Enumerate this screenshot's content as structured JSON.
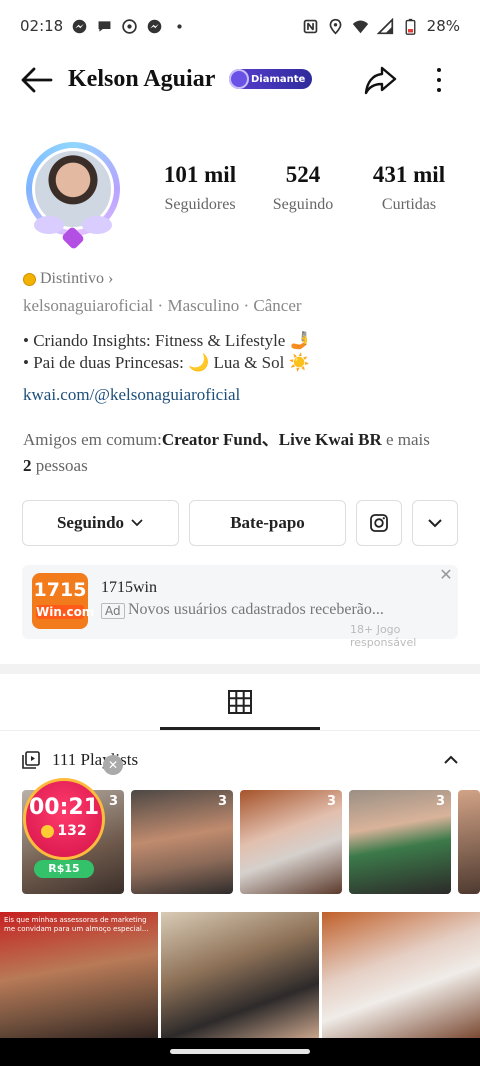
{
  "status_bar": {
    "time": "02:18",
    "notification_icons": [
      "messenger-icon",
      "chat-icon",
      "whatsapp-icon",
      "messenger-icon",
      "dot-icon"
    ],
    "system_icons": [
      "nfc-icon",
      "location-icon",
      "wifi-icon",
      "signal-icon",
      "battery-icon"
    ],
    "battery": "28%"
  },
  "header": {
    "name": "Kelson Aguiar",
    "tier": "Diamante",
    "tier_color": "#3b2fb0"
  },
  "stats": [
    {
      "value": "101 mil",
      "label": "Seguidores"
    },
    {
      "value": "524",
      "label": "Seguindo"
    },
    {
      "value": "431 mil",
      "label": "Curtidas"
    }
  ],
  "profile": {
    "badge_label": "Distintivo",
    "badge_chevron": "›",
    "meta": [
      "kelsonaguiaroficial",
      "Masculino",
      "Câncer"
    ],
    "meta_separator": " · ",
    "bio": [
      "• Criando Insights: Fitness & Lifestyle 🤳",
      "• Pai de duas Princesas: 🌙 Lua & Sol ☀️"
    ],
    "link": "kwai.com/@kelsonaguiaroficial",
    "mutual_prefix": "Amigos em comum:",
    "mutual_names": "Creator Fund、Live Kwai BR",
    "mutual_suffix": " e mais",
    "mutual_count": "2",
    "mutual_unit": " pessoas"
  },
  "actions": {
    "following_label": "Seguindo",
    "chat_label": "Bate-papo"
  },
  "ad": {
    "logo_number": "1715",
    "logo_word": "Win.com",
    "name": "1715win",
    "tag": "Ad",
    "text": "Novos usuários cadastrados receberão...",
    "disclaimer": "18+ Jogo responsável",
    "accent": "#f27b1b"
  },
  "playlists": {
    "title": "111 Playlists",
    "thumbs": [
      {
        "count": "3"
      },
      {
        "count": "3"
      },
      {
        "count": "3"
      },
      {
        "count": "3"
      }
    ]
  },
  "timer_widget": {
    "time": "00:21",
    "coins": "132",
    "reward": "R$15"
  },
  "videos": [
    {
      "caption": "Eis que minhas assessoras de marketing me convidam para um almoço especial..."
    }
  ]
}
